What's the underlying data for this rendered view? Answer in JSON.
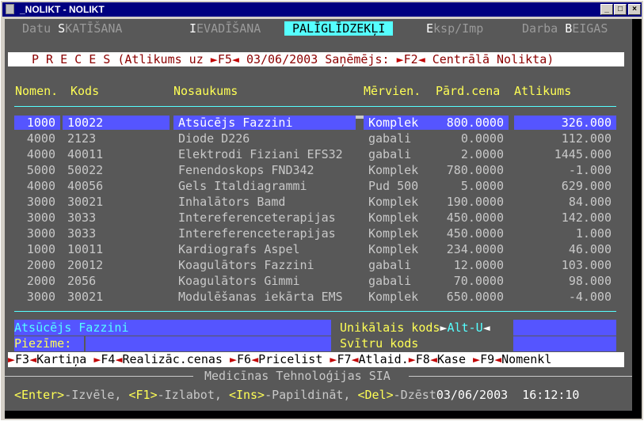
{
  "window": {
    "title": "_NOLIKT - NOLIKT",
    "btn_min": "_",
    "btn_max": "□",
    "btn_close": "×"
  },
  "menu": {
    "items": [
      {
        "pre": "Datu ",
        "hot": "S",
        "post": "KATĪŠANA"
      },
      {
        "pre": "",
        "hot": "I",
        "post": "EVADĪŠANA"
      },
      {
        "pre": "",
        "hot": "",
        "post": "PALĪGLĪDZEKĻI"
      },
      {
        "pre": "",
        "hot": "E",
        "post": "ksp/Imp"
      },
      {
        "pre": "Darba ",
        "hot": "B",
        "post": "EIGAS"
      }
    ]
  },
  "header": {
    "title": "P R E C E S",
    "balance_label": "(Atlikums uz",
    "key_f5": "F5",
    "date": "03/06/2003",
    "receiver_label": "Saņēmējs:",
    "key_f2": "F2",
    "receiver": "Centrālā Nolikta)"
  },
  "columns": [
    "Nomen.",
    "Kods",
    "Nosaukums",
    "Mērvien.",
    "Pārd.cena",
    "Atlikums"
  ],
  "rows": [
    [
      "1000",
      "10022",
      "Atsūcējs Fazzini",
      "Komplek",
      "800.0000",
      "326.000"
    ],
    [
      "4000",
      "2123",
      "Diode D226",
      "gabali",
      "0.0000",
      "112.000"
    ],
    [
      "4000",
      "40011",
      "Elektrodi Fiziani EFS32",
      "gabali",
      "2.0000",
      "1445.000"
    ],
    [
      "5000",
      "50022",
      "Fenendoskops FND342",
      "Komplek",
      "780.0000",
      "-1.000"
    ],
    [
      "4000",
      "40056",
      "Gels Italdiagrammi",
      "Pud 500",
      "5.0000",
      "629.000"
    ],
    [
      "3000",
      "30021",
      "Inhalātors Bamd",
      "Komplek",
      "190.0000",
      "84.000"
    ],
    [
      "3000",
      "3033",
      "Intereferenceterapijas",
      "Komplek",
      "450.0000",
      "142.000"
    ],
    [
      "3000",
      "3033",
      "Intereferenceterapijas",
      "Komplek",
      "450.0000",
      "1.000"
    ],
    [
      "1000",
      "10011",
      "Kardiografs Aspel",
      "Komplek",
      "234.0000",
      "46.000"
    ],
    [
      "2000",
      "20012",
      "Koagulātors Fazzini",
      "gabali",
      "12.0000",
      "103.000"
    ],
    [
      "2000",
      "2056",
      "Koagulātors Gimmi",
      "gabali",
      "70.0000",
      "98.000"
    ],
    [
      "3000",
      "30021",
      "Modulēšanas iekārta EMS",
      "Komplek",
      "650.0000",
      "-4.000"
    ]
  ],
  "detail": {
    "name": "Atsūcējs Fazzini",
    "unique_code_label": "Unikālais kods",
    "unique_code_key": "Alt-U",
    "note_label": "Piezīme:",
    "barcode_label": "Svītru kods"
  },
  "fkeys": [
    {
      "key": "F3",
      "label": "Kartiņa"
    },
    {
      "key": "F4",
      "label": "Realizāc.cenas"
    },
    {
      "key": "F6",
      "label": "Pricelist"
    },
    {
      "key": "F7",
      "label": "Atlaid."
    },
    {
      "key": "F8",
      "label": "Kase"
    },
    {
      "key": "F9",
      "label": "Nomenkl"
    }
  ],
  "company": "Medicīnas Tehnoloģijas SIA",
  "status": {
    "hints": [
      {
        "key": "<Enter>",
        "label": "-Izvēle, "
      },
      {
        "key": "<F1>",
        "label": "-Izlabot, "
      },
      {
        "key": "<Ins>",
        "label": "-Papildināt, "
      },
      {
        "key": "<Del>",
        "label": "-Dzēst"
      }
    ],
    "datetime": "03/06/2003  16:12:10"
  },
  "colors": {
    "console_bg": "#585858",
    "highlight": "#5555ff",
    "menu_active": "#55ffff",
    "header_fg": "#ffff55"
  }
}
